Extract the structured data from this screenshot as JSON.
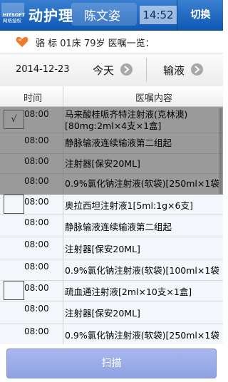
{
  "header": {
    "watermark_line1": "HiTSOFT",
    "watermark_line2": "网络授权",
    "app_title": "动护理",
    "user_name": "陈文姿",
    "clock": "14:52",
    "switch_label": "切换"
  },
  "patient": {
    "summary": "骆 标 01床 79岁 医嘱一览："
  },
  "filter": {
    "date": "2014-12-23",
    "day_label": "今天",
    "type_label": "输液"
  },
  "columns": {
    "time": "时间",
    "content": "医嘱内容"
  },
  "rows": [
    {
      "time": "08:00",
      "content": "马来酸桂哌齐特注射液(克林澳)[80mg:2ml×4支×1盒]"
    },
    {
      "time": "08:00",
      "content": "静脉输液连续输液第二组起"
    },
    {
      "time": "08:00",
      "content": "注射器[保安20ML]"
    },
    {
      "time": "08:00",
      "content": "0.9%氯化钠注射液(软袋)[250ml×1袋"
    },
    {
      "time": "08:00",
      "content": "奥拉西坦注射液1[5ml:1g×6支]"
    },
    {
      "time": "08:00",
      "content": "静脉输液连续输液第二组起"
    },
    {
      "time": "08:00",
      "content": "注射器[保安20ML]"
    },
    {
      "time": "08:00",
      "content": "0.9%氯化钠注射液(软袋)[100ml×1袋"
    },
    {
      "time": "08:00",
      "content": "疏血通注射液[2ml×10支×1盒]"
    },
    {
      "time": "08:00",
      "content": "注射器[保安20ML]"
    },
    {
      "time": "08:00",
      "content": "0.9%氯化钠注射液(软袋)[250ml×1袋"
    }
  ],
  "group1_check": "√",
  "footer": {
    "scan_label": "扫描"
  },
  "colors": {
    "header_blue": "#0f58b4",
    "selected_row": "#9a9a9a",
    "scan_button": "#8ea2e3",
    "heart": "#f07a2a"
  },
  "icons": [
    "heart-icon",
    "chevron-right-icon"
  ]
}
